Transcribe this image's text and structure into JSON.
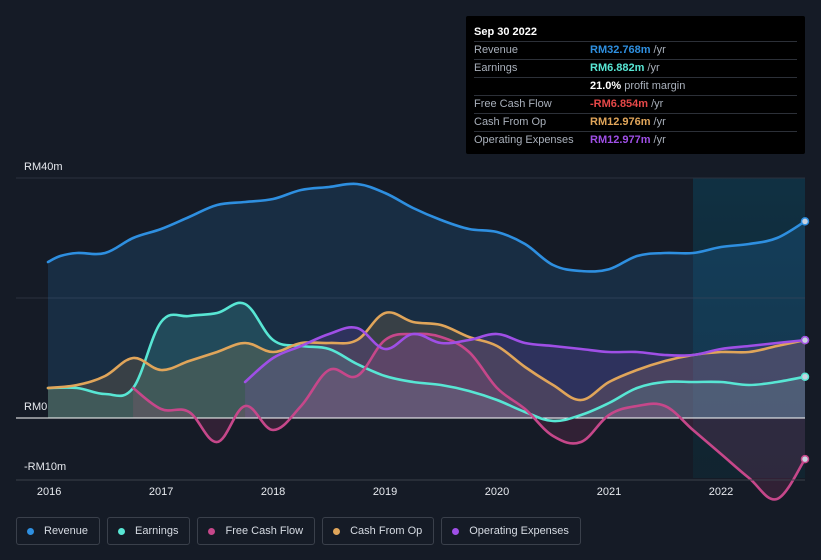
{
  "chart_data": {
    "type": "area",
    "x_ticks": [
      "2016",
      "2017",
      "2018",
      "2019",
      "2020",
      "2021",
      "2022"
    ],
    "y_ticks": [
      {
        "label": "RM40m",
        "value": 40
      },
      {
        "label": "RM0",
        "value": 0
      },
      {
        "label": "-RM10m",
        "value": -10
      }
    ],
    "ylim": [
      -10,
      40
    ],
    "xlim": [
      2015.99,
      2022.75
    ],
    "forecast_start": 2021.75,
    "series": [
      {
        "name": "Revenue",
        "color": "#2e8fe0",
        "x": [
          2015.99,
          2016.1,
          2016.25,
          2016.5,
          2016.75,
          2017.0,
          2017.25,
          2017.5,
          2017.75,
          2018.0,
          2018.25,
          2018.5,
          2018.75,
          2019.0,
          2019.25,
          2019.5,
          2019.75,
          2020.0,
          2020.25,
          2020.5,
          2020.75,
          2021.0,
          2021.25,
          2021.5,
          2021.75,
          2022.0,
          2022.25,
          2022.5,
          2022.75
        ],
        "y": [
          26,
          27,
          27.5,
          27.5,
          30,
          31.5,
          33.5,
          35.5,
          36,
          36.5,
          38,
          38.5,
          39,
          37.5,
          35,
          33,
          31.5,
          31,
          29,
          25.5,
          24.5,
          24.8,
          27,
          27.5,
          27.5,
          28.5,
          29,
          30,
          32.768
        ]
      },
      {
        "name": "Earnings",
        "color": "#58e6d4",
        "x": [
          2015.99,
          2016.25,
          2016.5,
          2016.75,
          2017.0,
          2017.25,
          2017.5,
          2017.75,
          2018.0,
          2018.25,
          2018.5,
          2018.75,
          2019.0,
          2019.25,
          2019.5,
          2019.75,
          2020.0,
          2020.25,
          2020.5,
          2020.75,
          2021.0,
          2021.25,
          2021.5,
          2021.75,
          2022.0,
          2022.25,
          2022.5,
          2022.75
        ],
        "y": [
          5,
          5,
          4,
          5,
          16,
          17,
          17.5,
          19,
          13,
          12,
          11.5,
          9,
          7,
          6,
          5.5,
          4.5,
          3,
          1,
          -0.5,
          0.5,
          2.5,
          5,
          6,
          6,
          6,
          5.5,
          6,
          6.882
        ]
      },
      {
        "name": "Free Cash Flow",
        "color": "#c6478a",
        "x": [
          2016.75,
          2017.0,
          2017.25,
          2017.5,
          2017.75,
          2018.0,
          2018.25,
          2018.5,
          2018.75,
          2019.0,
          2019.25,
          2019.5,
          2019.75,
          2020.0,
          2020.25,
          2020.5,
          2020.75,
          2021.0,
          2021.25,
          2021.5,
          2021.75,
          2022.0,
          2022.25,
          2022.5,
          2022.75
        ],
        "y": [
          5,
          1.5,
          1,
          -4,
          2,
          -2,
          2,
          8,
          7,
          13,
          14,
          13.5,
          11,
          5,
          1.5,
          -3,
          -4,
          0.5,
          2,
          2,
          -2,
          -6,
          -10,
          -13.5,
          -6.854
        ]
      },
      {
        "name": "Cash From Op",
        "color": "#e0a55a",
        "x": [
          2015.99,
          2016.25,
          2016.5,
          2016.75,
          2017.0,
          2017.25,
          2017.5,
          2017.75,
          2018.0,
          2018.25,
          2018.5,
          2018.75,
          2019.0,
          2019.25,
          2019.5,
          2019.75,
          2020.0,
          2020.25,
          2020.5,
          2020.75,
          2021.0,
          2021.25,
          2021.5,
          2021.75,
          2022.0,
          2022.25,
          2022.5,
          2022.75
        ],
        "y": [
          5,
          5.5,
          7,
          10,
          8,
          9.5,
          11,
          12.5,
          11,
          12.5,
          12.5,
          13,
          17.5,
          16,
          15.5,
          13.5,
          12,
          8.5,
          5.5,
          3,
          6,
          8,
          9.5,
          10.5,
          11,
          11,
          12,
          12.976
        ]
      },
      {
        "name": "Operating Expenses",
        "color": "#9f4fe6",
        "x": [
          2017.75,
          2018.0,
          2018.25,
          2018.5,
          2018.75,
          2019.0,
          2019.25,
          2019.5,
          2019.75,
          2020.0,
          2020.25,
          2020.5,
          2020.75,
          2021.0,
          2021.25,
          2021.5,
          2021.75,
          2022.0,
          2022.25,
          2022.5,
          2022.75
        ],
        "y": [
          6,
          10,
          12,
          14,
          15,
          11.5,
          14,
          12.5,
          13,
          14,
          12.5,
          12,
          11.5,
          11,
          11,
          10.5,
          10.5,
          11.5,
          12,
          12.5,
          12.977
        ]
      }
    ]
  },
  "tooltip": {
    "date": "Sep 30 2022",
    "rows": [
      {
        "label": "Revenue",
        "value": "RM32.768m",
        "unit": "/yr",
        "color": "#2e8fe0"
      },
      {
        "label": "Earnings",
        "value": "RM6.882m",
        "unit": "/yr",
        "color": "#58e6d4"
      },
      {
        "label": "",
        "value": "21.0%",
        "unit": "profit margin",
        "color": "#ffffff"
      },
      {
        "label": "Free Cash Flow",
        "value": "-RM6.854m",
        "unit": "/yr",
        "color": "#e64848"
      },
      {
        "label": "Cash From Op",
        "value": "RM12.976m",
        "unit": "/yr",
        "color": "#e0a55a"
      },
      {
        "label": "Operating Expenses",
        "value": "RM12.977m",
        "unit": "/yr",
        "color": "#9f4fe6"
      }
    ]
  },
  "legend": [
    {
      "label": "Revenue",
      "color": "#2e8fe0"
    },
    {
      "label": "Earnings",
      "color": "#58e6d4"
    },
    {
      "label": "Free Cash Flow",
      "color": "#c6478a"
    },
    {
      "label": "Cash From Op",
      "color": "#e0a55a"
    },
    {
      "label": "Operating Expenses",
      "color": "#9f4fe6"
    }
  ]
}
